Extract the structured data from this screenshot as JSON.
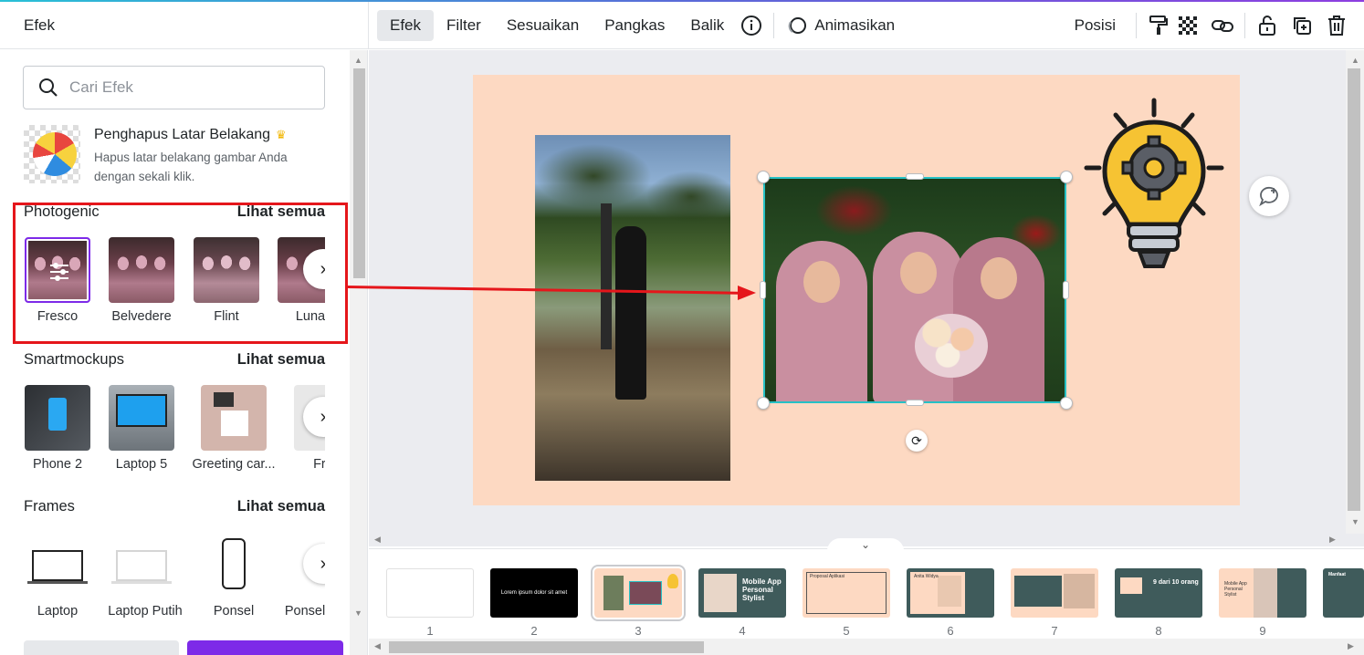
{
  "panel": {
    "title": "Efek",
    "search_placeholder": "Cari Efek",
    "bg_remover": {
      "title": "Penghapus Latar Belakang",
      "desc": "Hapus latar belakang gambar Anda dengan sekali klik."
    },
    "sections": [
      {
        "title": "Photogenic",
        "link": "Lihat semua",
        "items": [
          "Fresco",
          "Belvedere",
          "Flint",
          "Luna"
        ]
      },
      {
        "title": "Smartmockups",
        "link": "Lihat semua",
        "items": [
          "Phone 2",
          "Laptop 5",
          "Greeting car...",
          "Fran"
        ]
      },
      {
        "title": "Frames",
        "link": "Lihat semua",
        "items": [
          "Laptop",
          "Laptop Putih",
          "Ponsel",
          "Ponsel"
        ]
      }
    ]
  },
  "toolbar": {
    "efek": "Efek",
    "filter": "Filter",
    "sesuaikan": "Sesuaikan",
    "pangkas": "Pangkas",
    "balik": "Balik",
    "animasikan": "Animasikan",
    "posisi": "Posisi"
  },
  "filmstrip": {
    "pages": [
      "1",
      "2",
      "3",
      "4",
      "5",
      "6",
      "7",
      "8",
      "9"
    ],
    "thumb_texts": {
      "p2": "Lorem ipsum dolor sit amet",
      "p4": "Mobile App Personal Stylist",
      "p5": "Proposal Aplikasi",
      "p6": "Anita Widya",
      "p8": "9 dari 10 orang",
      "p9": "Mobile App Personal Stylist",
      "p10": "Manfaat"
    }
  },
  "colors": {
    "accent": "#7d2ae8",
    "annotation_red": "#e5161b",
    "slide_bg": "#fdd9c2",
    "selection": "#27c1c5"
  }
}
